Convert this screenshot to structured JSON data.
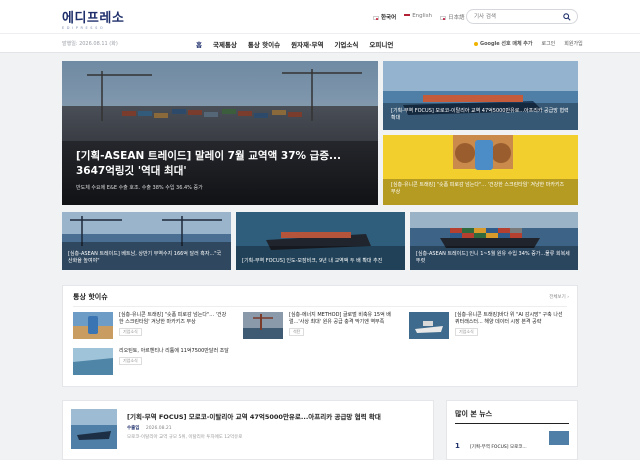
{
  "header": {
    "logo_main": "에디프레소",
    "logo_sub": "EDIPRESSO",
    "languages": [
      {
        "label": "한국어",
        "active": true,
        "flag": "flag-kr-icon"
      },
      {
        "label": "English",
        "active": false,
        "flag": "flag-us-icon"
      },
      {
        "label": "日本語",
        "active": false,
        "flag": "flag-jp-icon"
      }
    ],
    "search_placeholder": "기사 검색"
  },
  "nav": {
    "date": "발행일: 2026.08.11 (화)",
    "items": [
      "홈",
      "국제통상",
      "통상 핫이슈",
      "원자재·무역",
      "기업소식",
      "오피니언"
    ],
    "google_label": "Google 선호 매체 추가",
    "login": "로그인",
    "signup": "회원가입"
  },
  "hero": {
    "title": "[기획-ASEAN 트레이드] 말레이 7월 교역액 37% 급증... 3647억링깃 '역대 최대'",
    "summary": "반도체 수요에 E&E 수출 호조. 수출 38% 수입 36.4% 증가"
  },
  "side_cards": [
    {
      "title": "[기획-무역 FOCUS] 모로코-이탈리아 교역 47억5000만유로...아프리카 공급망 협력 확대"
    },
    {
      "title": "[심층-유니콘 트래킹] \"숏폼 피로감 넘는다\"... '건강한 스크린타임' 겨냥한 마카키즈 부상"
    }
  ],
  "tiles": [
    {
      "title": "[심층-ASEAN 트레이드] 베트남, 상반기 무역수지 166억 달러 흑자...\"국산화율 높여야\""
    },
    {
      "title": "[기획-무역 FOCUS] 인도-모잠비크, 9년 내 교역액 두 배 확대 추진"
    },
    {
      "title": "[심층-ASEAN 트레이드] 인니 1~5월 원유 수입 34% 증가...물류 회복세 뚜렷"
    }
  ],
  "hot_issues": {
    "title": "통상 핫이슈",
    "more": "전체보기 ›",
    "items": [
      {
        "title": "[심층-유니콘 트래킹] \"숏폼 피로감 넘는다\"... '건강한 스크린타임' 겨냥한 마카키즈 부상",
        "tag": "기업소식"
      },
      {
        "title": "[심층-에너지 METHOD] 글로벌 비축유 15억 배럴...'사상 최대' 원유 공급 충격 막기엔 역부족",
        "tag": "석탄"
      },
      {
        "title": "[심층-유니콘 트래킹]바다 위 \"AI 감시망\" 구축 나선 퀴터래스터... 해양 데이터 시장 본격 공략",
        "tag": "기업소식"
      },
      {
        "title": "리오틴토, 아르헨티나 리튬에 11억7500만달러 조달",
        "tag": "기업소식"
      }
    ]
  },
  "article": {
    "title": "[기획-무역 FOCUS] 모로코-이탈리아 교역 47억5000만유로...아프리카 공급망 협력 확대",
    "tag": "수출입",
    "date": "2026.08.21",
    "summary": "모로코-이탈리아 교역 규모 5위, 이탈리아 투자에도 12억유로"
  },
  "popular": {
    "title": "많이 본 뉴스",
    "items": [
      {
        "rank": "1",
        "title": "[기획-무역 FOCUS] 모로코..."
      }
    ]
  },
  "colors": {
    "brand": "#1e2f6b",
    "accent": "#f0b400",
    "bg": "#f1f2f4"
  }
}
